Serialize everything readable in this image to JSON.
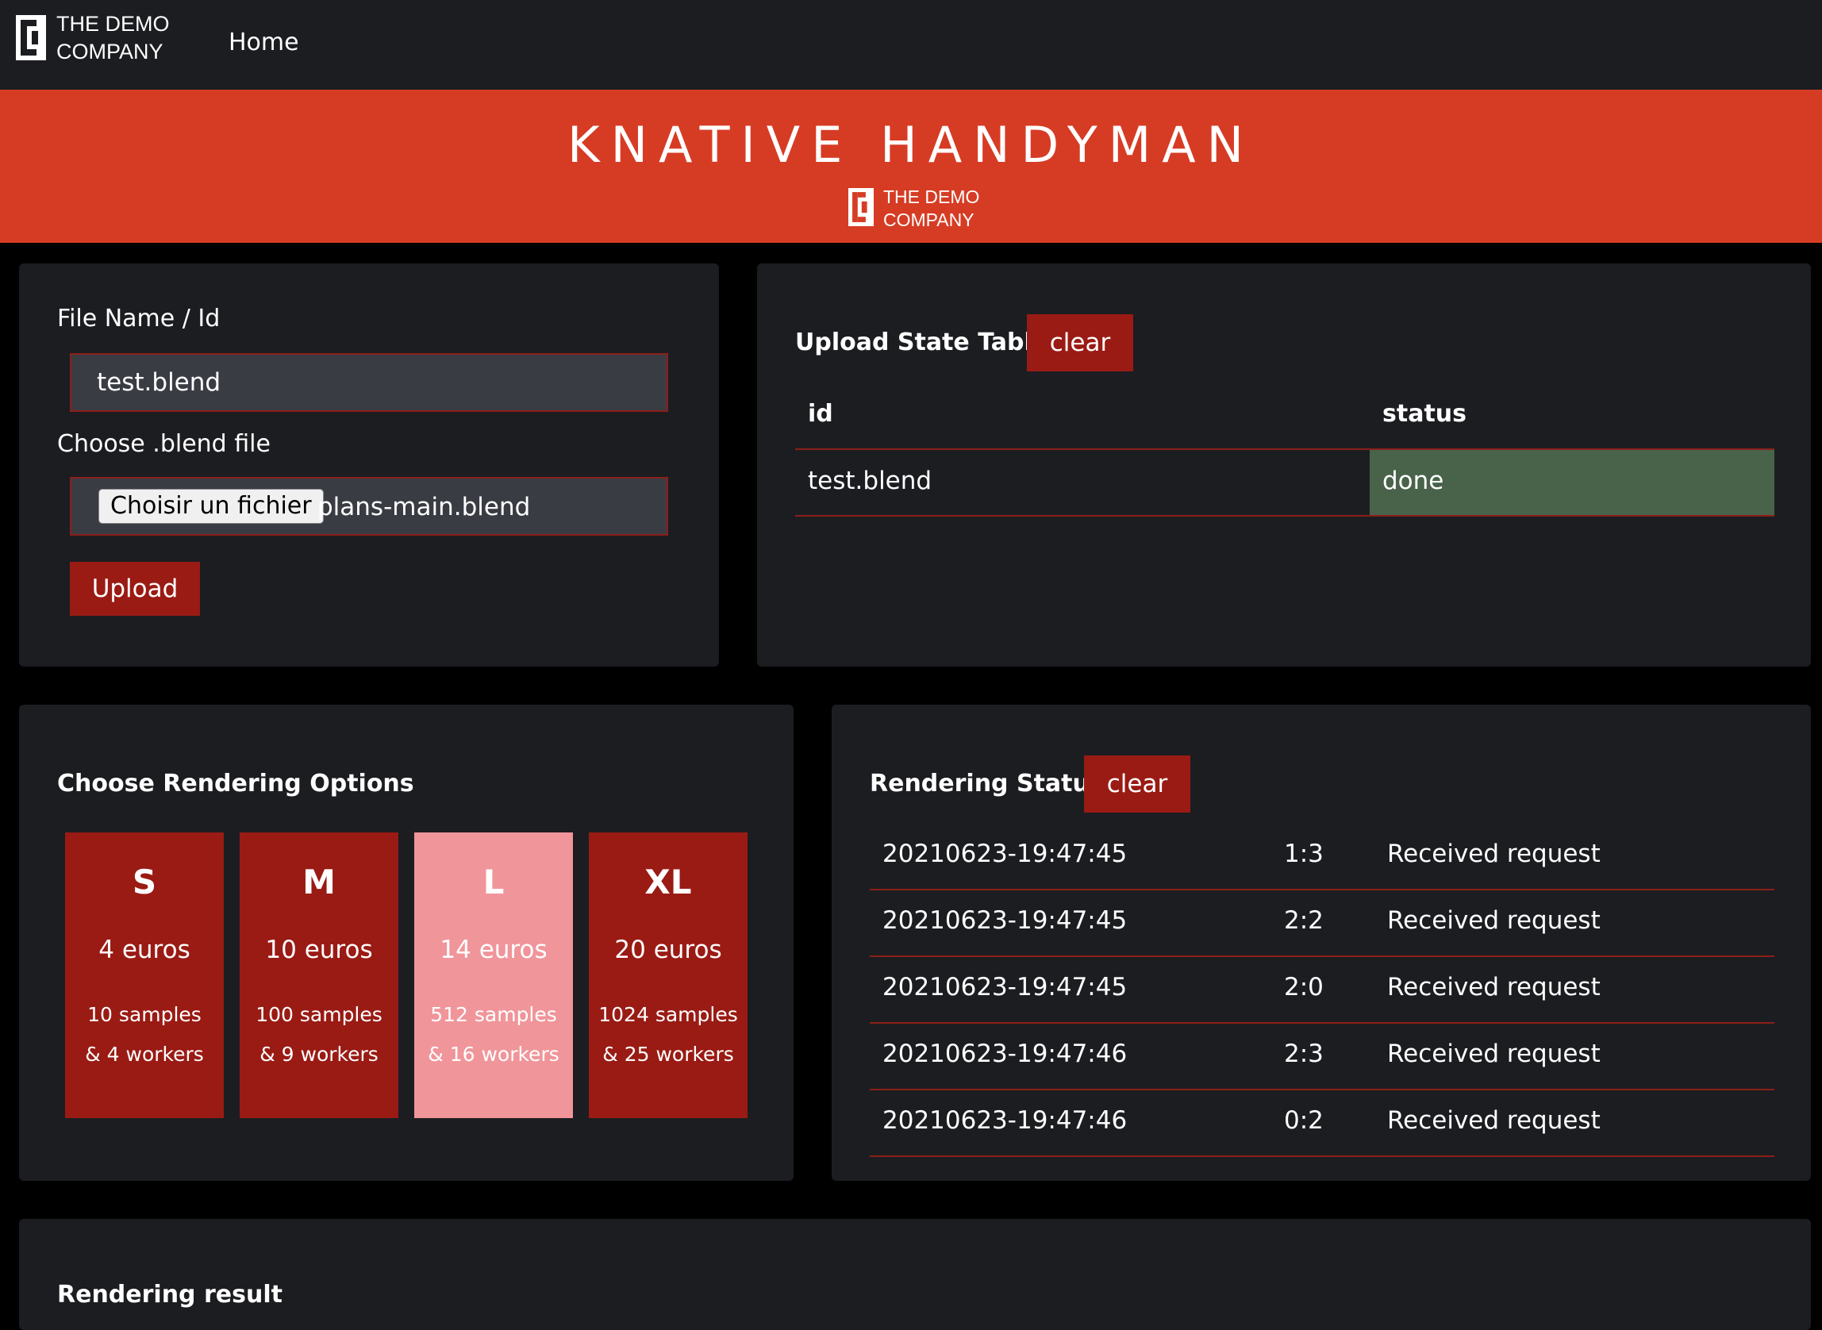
{
  "nav": {
    "logo_line1": "THE DEMO",
    "logo_line2": "COMPANY",
    "home_label": "Home"
  },
  "banner": {
    "title": "KNATIVE HANDYMAN",
    "logo_line1": "THE DEMO",
    "logo_line2": "COMPANY"
  },
  "upload_form": {
    "filename_label": "File Name / Id",
    "filename_value": "test.blend",
    "choose_label": "Choose .blend file",
    "chooser_button": "Choisir un fichier",
    "chosen_file": "plans-main.blend",
    "upload_button": "Upload"
  },
  "upload_state": {
    "heading": "Upload State Table",
    "clear_button": "clear",
    "columns": [
      "id",
      "status"
    ],
    "rows": [
      {
        "id": "test.blend",
        "status": "done"
      }
    ]
  },
  "rendering_options": {
    "heading": "Choose Rendering Options",
    "selected": "L",
    "options": [
      {
        "size": "S",
        "price": "4 euros",
        "samples": "10 samples",
        "workers": "& 4 workers"
      },
      {
        "size": "M",
        "price": "10 euros",
        "samples": "100 samples",
        "workers": "& 9 workers"
      },
      {
        "size": "L",
        "price": "14 euros",
        "samples": "512 samples",
        "workers": "& 16 workers"
      },
      {
        "size": "XL",
        "price": "20 euros",
        "samples": "1024 samples",
        "workers": "& 25 workers"
      }
    ]
  },
  "rendering_status": {
    "heading": "Rendering Status",
    "clear_button": "clear",
    "rows": [
      {
        "time": "20210623-19:47:45",
        "code": "1:3",
        "message": "Received request"
      },
      {
        "time": "20210623-19:47:45",
        "code": "2:2",
        "message": "Received request"
      },
      {
        "time": "20210623-19:47:45",
        "code": "2:0",
        "message": "Received request"
      },
      {
        "time": "20210623-19:47:46",
        "code": "2:3",
        "message": "Received request"
      },
      {
        "time": "20210623-19:47:46",
        "code": "0:2",
        "message": "Received request"
      }
    ]
  },
  "rendering_result": {
    "heading": "Rendering result"
  },
  "colors": {
    "brand_banner": "#d63c24",
    "button_red": "#9a1b14",
    "selected_option": "#f0959a",
    "status_done": "#48634a",
    "panel_bg": "#1c1d21"
  }
}
